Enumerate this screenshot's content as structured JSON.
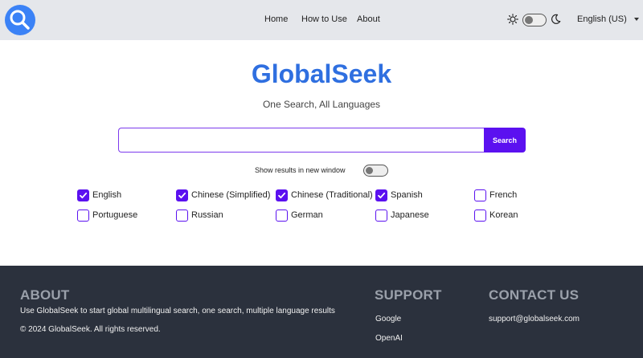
{
  "header": {
    "nav": [
      "Home",
      "How to Use",
      "About"
    ],
    "language": "English (US)"
  },
  "main": {
    "brand": "GlobalSeek",
    "tagline": "One Search, All Languages",
    "search": {
      "value": "",
      "placeholder": "",
      "button_label": "Search"
    },
    "new_window": {
      "label": "Show results in new window",
      "enabled": false
    },
    "languages": [
      {
        "label": "English",
        "checked": true
      },
      {
        "label": "Chinese (Simplified)",
        "checked": true
      },
      {
        "label": "Chinese (Traditional)",
        "checked": true
      },
      {
        "label": "Spanish",
        "checked": true
      },
      {
        "label": "French",
        "checked": false
      },
      {
        "label": "Portuguese",
        "checked": false
      },
      {
        "label": "Russian",
        "checked": false
      },
      {
        "label": "German",
        "checked": false
      },
      {
        "label": "Japanese",
        "checked": false
      },
      {
        "label": "Korean",
        "checked": false
      }
    ]
  },
  "footer": {
    "about": {
      "heading": "ABOUT",
      "description": "Use GlobalSeek to start global multilingual search, one search, multiple language results",
      "copyright": "© 2024 GlobalSeek. All rights reserved."
    },
    "support": {
      "heading": "SUPPORT",
      "links": [
        "Google",
        "OpenAI"
      ]
    },
    "contact": {
      "heading": "CONTACT US",
      "email": "support@globalseek.com"
    }
  },
  "colors": {
    "brand": "#2f6fe0",
    "accent": "#5b11f0",
    "header_bg": "#e5e7eb",
    "footer_bg": "#2b313d",
    "footer_heading": "#9aa0aa"
  }
}
